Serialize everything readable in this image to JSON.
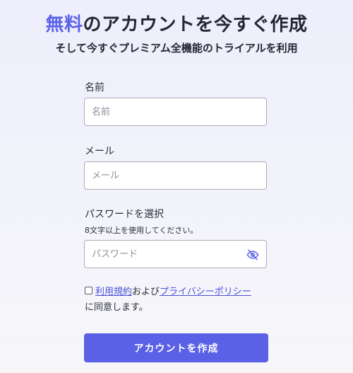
{
  "header": {
    "title_accent": "無料",
    "title_rest": "のアカウントを今すぐ作成",
    "subtitle": "そして今すぐプレミアム全機能のトライアルを利用"
  },
  "form": {
    "name": {
      "label": "名前",
      "placeholder": "名前",
      "value": ""
    },
    "email": {
      "label": "メール",
      "placeholder": "メール",
      "value": ""
    },
    "password": {
      "label": "パスワードを選択",
      "hint": "8文字以上を使用してください。",
      "placeholder": "パスワード",
      "value": "",
      "toggle_icon": "eye-off-icon"
    },
    "terms": {
      "checked": false,
      "link_terms": "利用規約",
      "conjunction": "および",
      "link_privacy": "プライバシーポリシー",
      "suffix": "に同意します。"
    },
    "submit_label": "アカウントを作成"
  },
  "colors": {
    "accent": "#5b62e6",
    "button": "#5a61e6",
    "link": "#4a52d9",
    "background": "#eeeefc"
  }
}
